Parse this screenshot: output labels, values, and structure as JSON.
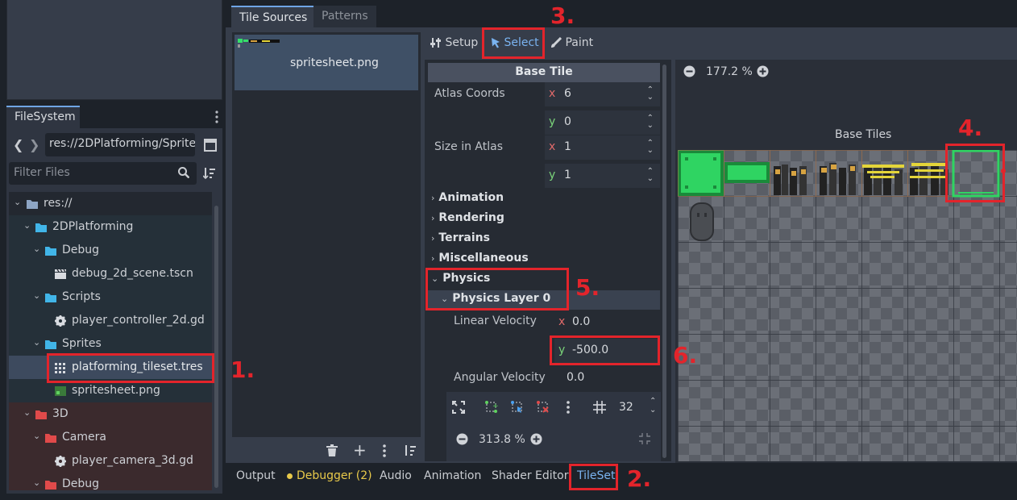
{
  "filesystem": {
    "tab_label": "FileSystem",
    "path": "res://2DPlatforming/Sprite",
    "filter_placeholder": "Filter Files",
    "tree": [
      {
        "label": "res://"
      },
      {
        "label": "2DPlatforming"
      },
      {
        "label": "Debug"
      },
      {
        "label": "debug_2d_scene.tscn"
      },
      {
        "label": "Scripts"
      },
      {
        "label": "player_controller_2d.gd"
      },
      {
        "label": "Sprites"
      },
      {
        "label": "platforming_tileset.tres"
      },
      {
        "label": "spritesheet.png"
      },
      {
        "label": "3D"
      },
      {
        "label": "Camera"
      },
      {
        "label": "player_camera_3d.gd"
      },
      {
        "label": "Debug"
      }
    ]
  },
  "tileset": {
    "tabs": [
      "Tile Sources",
      "Patterns"
    ],
    "source_item": "spritesheet.png",
    "modes": [
      "Setup",
      "Select",
      "Paint"
    ],
    "inspector": {
      "header": "Base Tile",
      "atlas_coords_label": "Atlas Coords",
      "atlas_x": "6",
      "atlas_y": "0",
      "size_label": "Size in Atlas",
      "size_x": "1",
      "size_y": "1",
      "sections": [
        "Animation",
        "Rendering",
        "Terrains",
        "Miscellaneous",
        "Physics"
      ],
      "physics_layer": "Physics Layer 0",
      "linear_velocity_label": "Linear Velocity",
      "linear_x": "0.0",
      "linear_y": "-500.0",
      "angular_velocity_label": "Angular Velocity",
      "angular_value": "0.0",
      "grid_size": "32",
      "zoom": "313.8 %"
    },
    "atlas": {
      "zoom": "177.2 %",
      "base_tiles_label": "Base Tiles"
    }
  },
  "bottom_tabs": [
    "Output",
    "Debugger (2)",
    "Audio",
    "Animation",
    "Shader Editor",
    "TileSet"
  ],
  "annotations": [
    "1.",
    "2.",
    "3.",
    "4.",
    "5.",
    "6."
  ],
  "colors": {
    "accent": "#6fa5e5",
    "annotation": "#e3242b",
    "warning": "#e8c94a"
  }
}
